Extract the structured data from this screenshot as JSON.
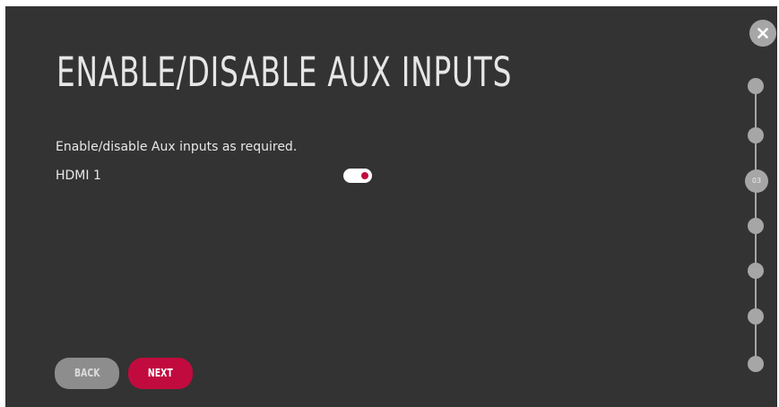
{
  "page": {
    "title": "ENABLE/DISABLE AUX INPUTS",
    "description": "Enable/disable Aux inputs as required."
  },
  "inputs": [
    {
      "label": "HDMI 1",
      "enabled": true
    }
  ],
  "buttons": {
    "back_label": "BACK",
    "next_label": "NEXT"
  },
  "stepper": {
    "current_step_label": "03",
    "total_steps": 7,
    "current_step": 3
  },
  "icons": {
    "close": "close-icon"
  },
  "colors": {
    "background": "#333333",
    "accent": "#c10b3e",
    "secondary_button": "#8d8d8d",
    "stepper": "#a6a6a6",
    "text": "#e8e8e8"
  }
}
